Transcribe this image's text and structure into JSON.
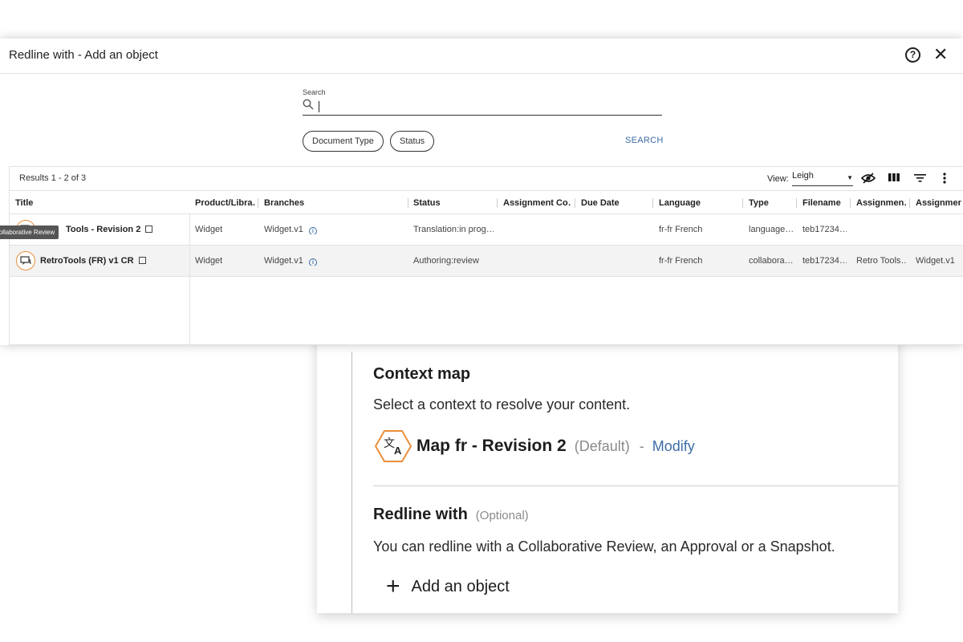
{
  "context_panel": {
    "context_heading": "Context map",
    "context_text": "Select a context to resolve your content.",
    "context_name": "Map fr - Revision 2",
    "context_default": "(Default)",
    "context_sep": "-",
    "modify_label": "Modify",
    "redline_heading": "Redline with",
    "redline_optional": "(Optional)",
    "redline_text": "You can redline with a Collaborative Review, an Approval or a Snapshot.",
    "add_object_label": "Add an object",
    "icon": "translate-hexagon-icon",
    "accent_color": "#e98f3a",
    "link_color": "#3d6da6"
  },
  "dialog": {
    "title": "Redline with - Add an object",
    "help_icon": "?",
    "close_icon": "✕",
    "search_label": "Search",
    "search_value": "",
    "filters": [
      "Document Type",
      "Status"
    ],
    "search_button": "SEARCH"
  },
  "results": {
    "count": "Results 1 - 2 of 3",
    "view_label": "View:",
    "view_value": "Leigh",
    "toolbar_icons": [
      "visibility-toggle-icon",
      "columns-icon",
      "filter-icon",
      "more-vert-icon"
    ],
    "columns": [
      "Title",
      "Product/Libra…",
      "Branches",
      "Status",
      "Assignment Co…",
      "Due Date",
      "Language",
      "Type",
      "Filename",
      "Assignmen…",
      "Assignmer"
    ],
    "rows": [
      {
        "title": "Tools - Revision 2",
        "product": "Widget",
        "branch": "Widget.v1",
        "status": "Translation:in prog…",
        "assignment_co": "",
        "due_date": "",
        "language": "fr-fr French",
        "type": "language…",
        "filename": "teb17234…",
        "assignment1": "",
        "assignment2": ""
      },
      {
        "title": "RetroTools (FR) v1 CR",
        "product": "Widget",
        "branch": "Widget.v1",
        "status": "Authoring:review",
        "assignment_co": "",
        "due_date": "",
        "language": "fr-fr French",
        "type": "collabora…",
        "filename": "teb17234…",
        "assignment1": "Retro Tools…",
        "assignment2": "Widget.v1"
      }
    ],
    "tooltip": "Collaborative Review"
  }
}
